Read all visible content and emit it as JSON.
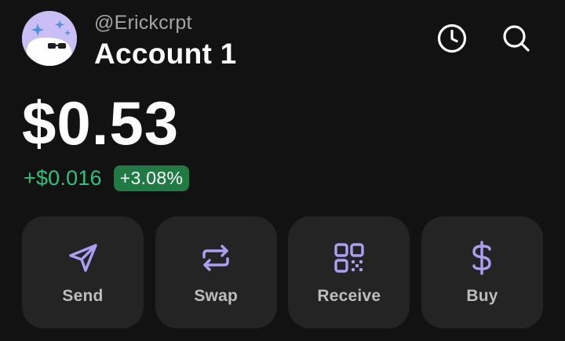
{
  "header": {
    "handle": "@Erickcrpt",
    "account_name": "Account 1",
    "avatar_icon": "ghost-avatar-with-sunglasses",
    "history_icon": "clock-icon",
    "search_icon": "search-icon"
  },
  "balance": {
    "value": "$0.53",
    "change_abs": "+$0.016",
    "change_pct": "+3.08%"
  },
  "actions": [
    {
      "label": "Send",
      "icon": "send-icon"
    },
    {
      "label": "Swap",
      "icon": "swap-icon"
    },
    {
      "label": "Receive",
      "icon": "qr-code-icon"
    },
    {
      "label": "Buy",
      "icon": "dollar-icon"
    }
  ],
  "colors": {
    "background": "#121212",
    "card": "#242424",
    "accent": "#ab9ff2",
    "positive": "#2ec27e",
    "positive_badge": "#1f7a44"
  }
}
